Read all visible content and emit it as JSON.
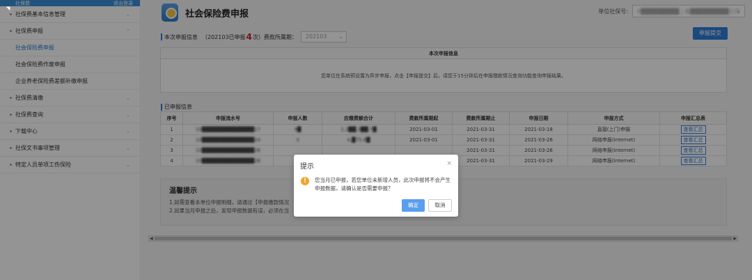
{
  "sidebar": {
    "top_left": "社保费",
    "top_right": "退出登录",
    "items": [
      {
        "label": "社保费基本信息管理"
      },
      {
        "label": "社保费申报"
      }
    ],
    "sub_items": [
      {
        "label": "社会保险费申报",
        "active": true
      },
      {
        "label": "社会保险费作废申报"
      },
      {
        "label": "企业养老保险费差额补缴申报"
      }
    ],
    "items_after": [
      {
        "label": "社保费清缴"
      },
      {
        "label": "社保费查询"
      },
      {
        "label": "下载中心"
      },
      {
        "label": "社保文书事项管理"
      },
      {
        "label": "特定人员单项工伤保险"
      }
    ]
  },
  "header": {
    "title": "社会保险费申报",
    "unit_label": "单位社保号:",
    "unit_value": "9█████████  | 福█████████公司"
  },
  "toolbar": {
    "submit_label": "申报提交"
  },
  "declaration": {
    "info_label": "本次申报信息",
    "info_text_pre": "（202103已申报",
    "count": "4",
    "info_text_post": "次）费款所属期：",
    "period": "202103"
  },
  "info_box": {
    "title": "本次申报信息",
    "body": "您单位在系统预设置为异步申报，点击【申报提交】后，请您于15分钟后在申报缴款情况查询功能查询申报结果。"
  },
  "declared": {
    "section_label": "已申报信息",
    "columns": [
      "序号",
      "申报流水号",
      "申报人数",
      "应缴费额合计",
      "费款所属期起",
      "费款所属期止",
      "申报日期",
      "申报方式",
      "申报汇总表"
    ],
    "rows": [
      {
        "no": "1",
        "serial": "10██████████████17",
        "people": "9█",
        "amount": "1,3██,3██.7█",
        "start": "2021-03-01",
        "end": "2021-03-31",
        "date": "2021-03-18",
        "method": "直接(上门)申报",
        "action": "查看汇总"
      },
      {
        "no": "2",
        "serial": "10██████████████24",
        "people": "3",
        "amount": "4,█75.8█",
        "start": "2021-03-01",
        "end": "2021-03-31",
        "date": "2021-03-26",
        "method": "网络申报(Internet)",
        "action": "查看汇总"
      },
      {
        "no": "3",
        "serial": "10██████████████26",
        "people": "",
        "amount": "",
        "start": "",
        "end": "2021-03-31",
        "date": "2021-03-26",
        "method": "网络申报(Internet)",
        "action": "查看汇总"
      },
      {
        "no": "4",
        "serial": "10██████████████28",
        "people": "",
        "amount": "",
        "start": "",
        "end": "2021-03-31",
        "date": "2021-03-29",
        "method": "网络申报(Internet)",
        "action": "查看汇总"
      }
    ]
  },
  "tips": {
    "title": "温馨提示",
    "lines": [
      "1.如需查看本单位申报明细，请通过【申报缴款情况",
      "2.如果当月申报之后，发现申报数据有误，必须在当"
    ]
  },
  "dialog": {
    "title": "提示",
    "close": "×",
    "message": "您当月已申报，若您单位未新增人员，此次申报将不会产生申报数据，请确认是否需要申报？",
    "confirm_label": "确定",
    "cancel_label": "取消"
  },
  "colors": {
    "accent": "#2f7ed8",
    "warning": "#f2a42b",
    "count_red": "#d02020"
  }
}
